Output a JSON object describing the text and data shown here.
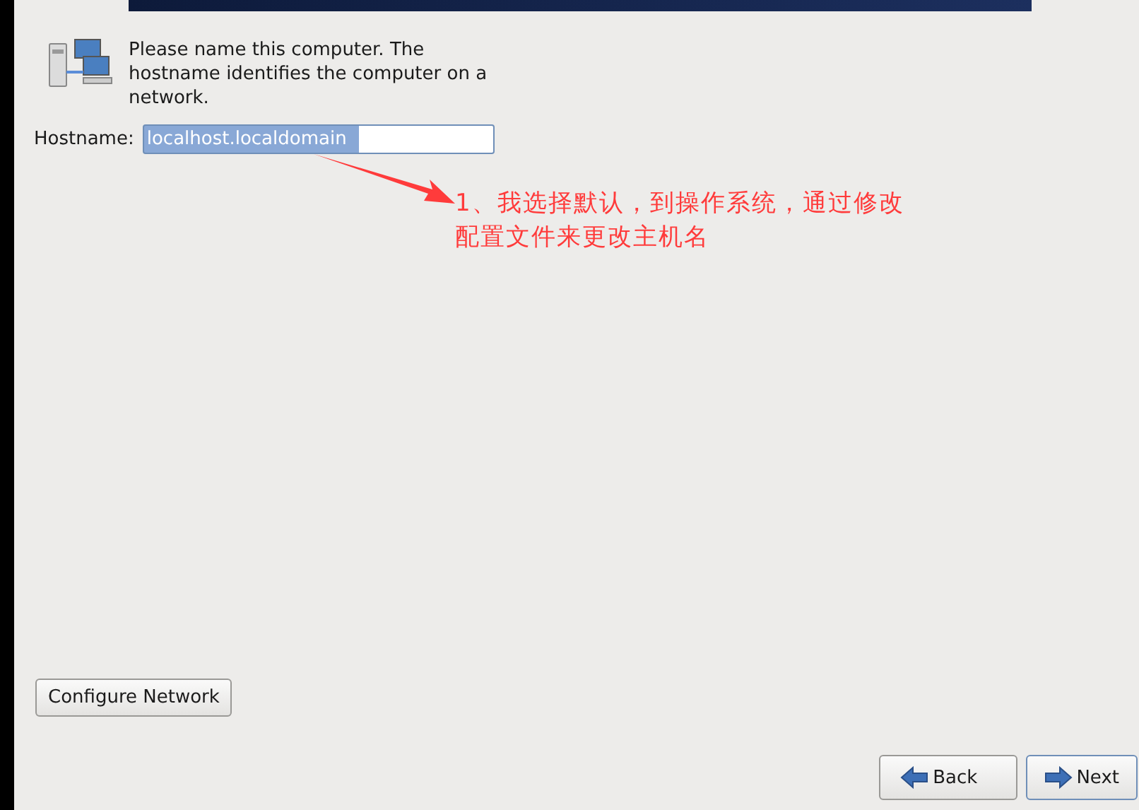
{
  "intro": {
    "text": "Please name this computer.  The hostname identifies the computer on a network."
  },
  "hostname": {
    "label": "Hostname:",
    "value": "localhost.localdomain",
    "selected": true
  },
  "annotation": {
    "text": "1、我选择默认，到操作系统，通过修改配置文件来更改主机名"
  },
  "configure_button": "Configure Network",
  "nav_buttons": [
    {
      "label": "Back",
      "kind": "back"
    },
    {
      "label": "Next",
      "kind": "next"
    }
  ]
}
